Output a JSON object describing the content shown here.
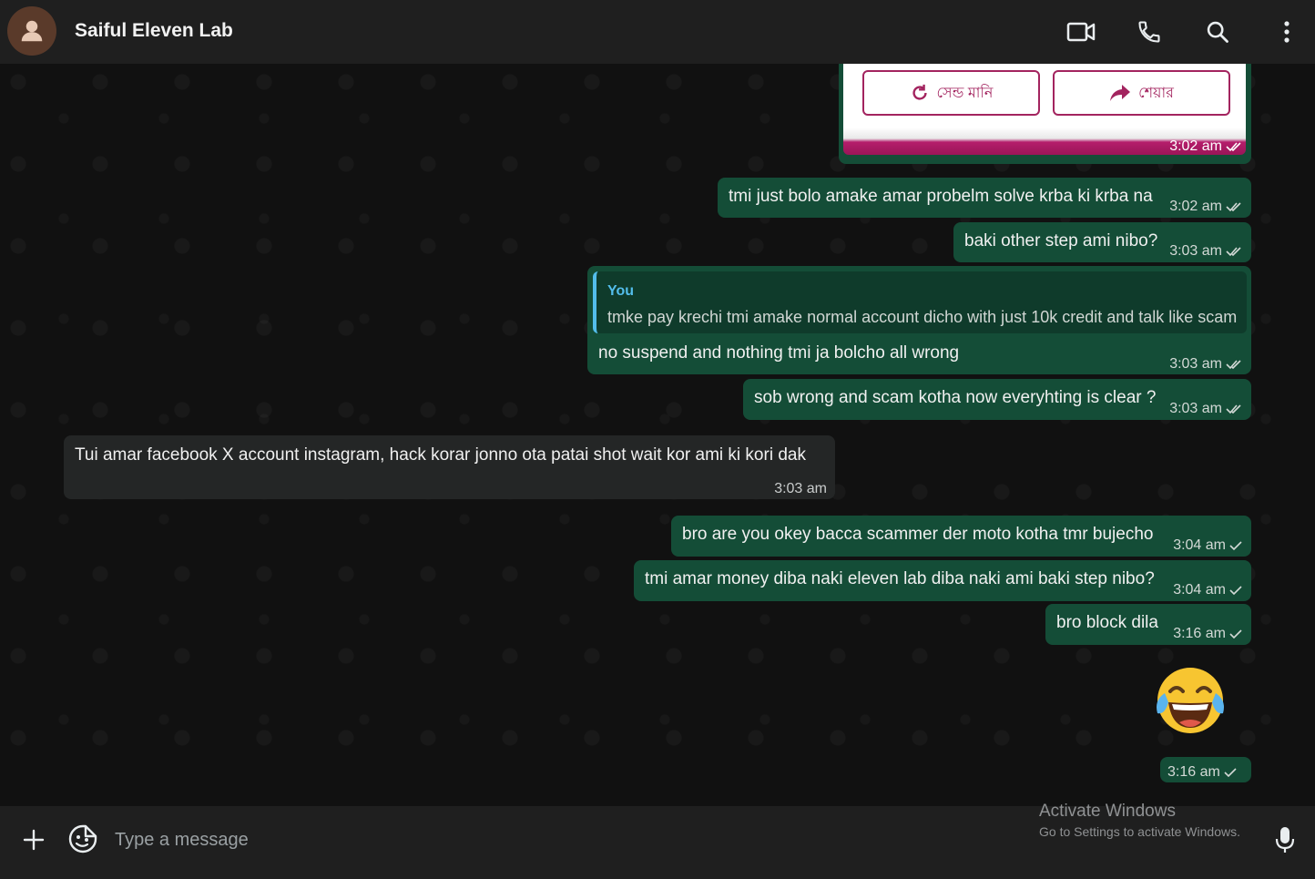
{
  "header": {
    "contact_name": "Saiful Eleven Lab",
    "icons": [
      "video-call-icon",
      "voice-call-icon",
      "search-icon",
      "menu-icon"
    ]
  },
  "image_card": {
    "buttons": [
      {
        "label": "সেন্ড মানি",
        "icon": "refresh-icon"
      },
      {
        "label": "শেয়ার",
        "icon": "share-arrow-icon"
      }
    ],
    "time": "3:02 am"
  },
  "messages": [
    {
      "direction": "out",
      "text": "tmi just bolo amake amar probelm solve krba ki krba na",
      "time": "3:02 am",
      "status": "read"
    },
    {
      "direction": "out",
      "text": "baki other step ami nibo?",
      "time": "3:03 am",
      "status": "read"
    },
    {
      "direction": "out",
      "reply_to": {
        "author": "You",
        "text": "tmke pay krechi tmi amake normal account dicho with just 10k credit and talk like scam"
      },
      "text": "no suspend and nothing tmi ja bolcho all wrong",
      "time": "3:03 am",
      "status": "read"
    },
    {
      "direction": "out",
      "text": "sob wrong and scam kotha now everyhting is clear ?",
      "time": "3:03 am",
      "status": "read"
    },
    {
      "direction": "in",
      "text": "Tui amar facebook X account instagram, hack korar jonno ota patai shot wait kor ami ki kori dak",
      "time": "3:03 am"
    },
    {
      "direction": "out",
      "text": "bro are you okey bacca scammer der moto kotha tmr bujecho",
      "time": "3:04 am",
      "status": "sent"
    },
    {
      "direction": "out",
      "text": "tmi amar money diba naki eleven lab diba naki ami baki step nibo?",
      "time": "3:04 am",
      "status": "sent"
    },
    {
      "direction": "out",
      "text": "bro block dila",
      "time": "3:16 am",
      "status": "sent"
    },
    {
      "direction": "out",
      "emoji": "face-with-tears-of-joy",
      "time": "3:16 am",
      "status": "sent"
    }
  ],
  "composer": {
    "placeholder": "Type a message",
    "icons": [
      "plus-icon",
      "sticker-icon",
      "microphone-icon"
    ]
  },
  "watermark": {
    "title": "Activate Windows",
    "subtitle": "Go to Settings to activate Windows."
  },
  "colors": {
    "header_bg": "#1f1f1f",
    "chat_bg": "#111111",
    "outgoing_bubble": "#144d37",
    "incoming_bubble": "#242626",
    "reply_accent": "#53bdeb",
    "card_accent": "#a3245f"
  }
}
